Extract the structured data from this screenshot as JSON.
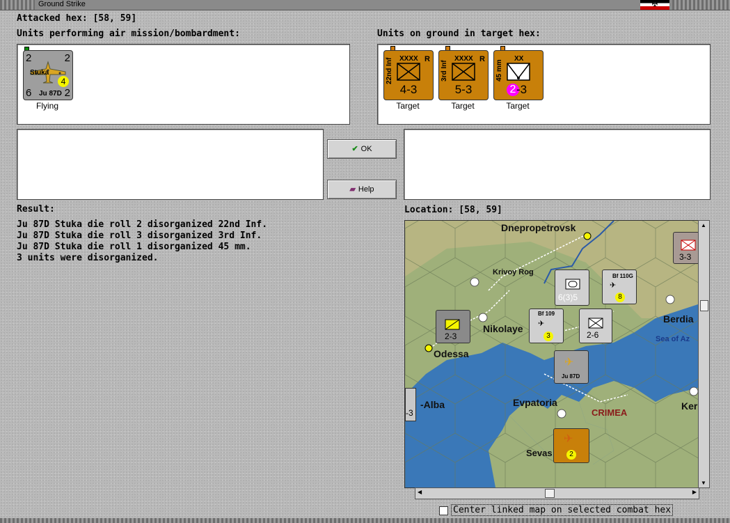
{
  "window": {
    "title": "Ground Strike"
  },
  "attacked_hex": "Attacked hex:  [58, 59]",
  "air_units": {
    "heading": "Units performing air mission/bombardment:",
    "units": [
      {
        "name": "Stuka",
        "model": "Ju 87D",
        "tl": "2",
        "tr": "2",
        "bl": "6",
        "br": "2",
        "badge": "4",
        "status": "Flying"
      }
    ]
  },
  "ground_units": {
    "heading": "Units on ground in target hex:",
    "units": [
      {
        "side_label": "22nd Inf",
        "size": "XXXX",
        "flag": "R",
        "strength": "4-3",
        "status": "Target"
      },
      {
        "side_label": "3rd Inf",
        "size": "XXXX",
        "flag": "R",
        "strength": "5-3",
        "status": "Target"
      },
      {
        "side_label": "45 mm",
        "size": "XX",
        "flag": "",
        "strength": "-3",
        "badge": "2",
        "status": "Target"
      }
    ]
  },
  "buttons": {
    "ok": "OK",
    "help": "Help"
  },
  "result": {
    "heading": "Result:",
    "lines": [
      "Ju 87D Stuka die roll 2 disorganized 22nd Inf.",
      "Ju 87D Stuka die roll 3 disorganized 3rd Inf.",
      "Ju 87D Stuka die roll 1 disorganized 45 mm.",
      "3 units were disorganized."
    ]
  },
  "location": "Location:   [58, 59]",
  "map": {
    "places": {
      "dnepropetrovsk": "Dnepropetrovsk",
      "krivoy_rog": "Krivoy Rog",
      "nikolayev": "Nikolaye",
      "odessa": "Odessa",
      "berdia": "Berdia",
      "sea_of_azov": "Sea of Az",
      "alba": "-Alba",
      "evpatoria": "Evpatoria",
      "crimea": "CRIMEA",
      "kerch": "Ker",
      "sevastopol": "Sevas"
    },
    "counters": {
      "c1": "3-3",
      "c2": "6(3)5",
      "c3": "Bf 110G",
      "c4": "8",
      "c5": "2-3",
      "c6": "Bf 109",
      "c7": "3",
      "c8": "2-6",
      "c9": "Ju 87D",
      "c10": "-3",
      "c11": "2"
    },
    "colors": {
      "sea": "#3a78b8",
      "land": "#9fb07a",
      "steppe": "#b7b582"
    }
  },
  "center_link": "Center linked map on selected combat hex"
}
